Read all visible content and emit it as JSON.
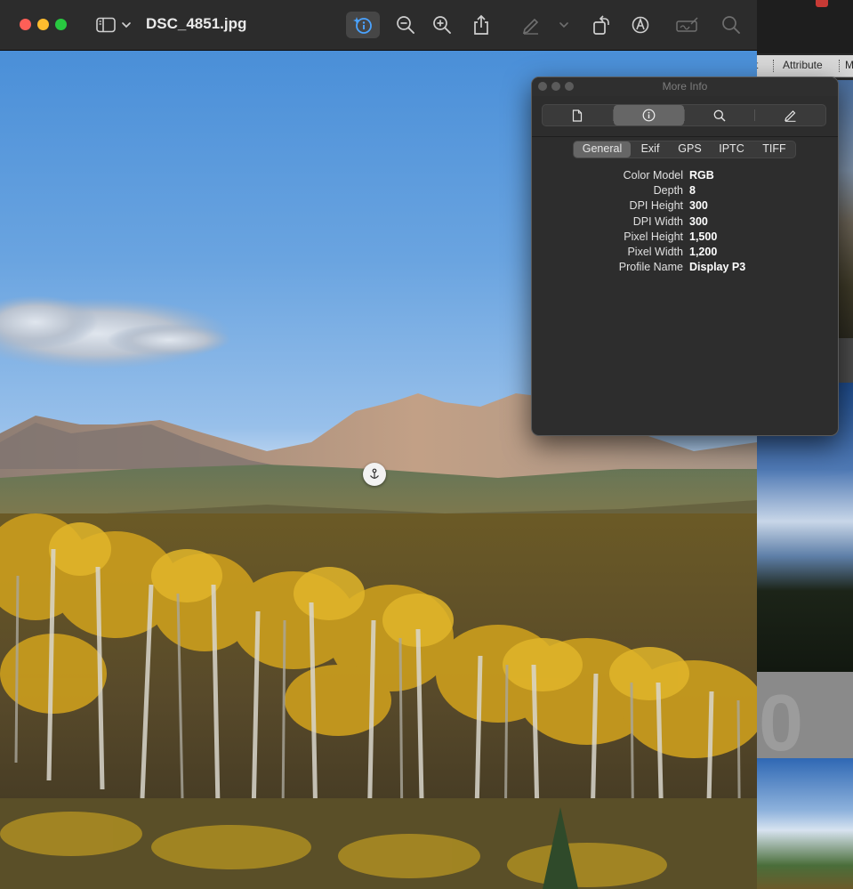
{
  "window": {
    "title": "DSC_4851.jpg"
  },
  "toolbar": {
    "sidebar_icon": "sidebar-icon",
    "sidebar_chevron_icon": "chevron-down-icon",
    "info_icon": "info-icon",
    "zoom_out_icon": "zoom-out-icon",
    "zoom_in_icon": "zoom-in-icon",
    "share_icon": "share-icon",
    "markup_pen_icon": "pen-icon",
    "markup_chevron_icon": "chevron-down-icon",
    "rotate_icon": "rotate-icon",
    "annotate_icon": "markup-circle-icon",
    "signature_icon": "signature-icon",
    "search_icon": "search-icon"
  },
  "background_app": {
    "tabs": [
      "t",
      "Attribute",
      "M"
    ],
    "big_text": "0"
  },
  "more_info": {
    "title": "More Info",
    "segments": [
      {
        "icon": "document-icon"
      },
      {
        "icon": "info-circle-icon",
        "active": true
      },
      {
        "icon": "magnifier-icon"
      },
      {
        "icon": "pencil-icon"
      }
    ],
    "tabs": [
      "General",
      "Exif",
      "GPS",
      "IPTC",
      "TIFF"
    ],
    "active_tab": "General",
    "rows": [
      {
        "key": "Color Model",
        "value": "RGB"
      },
      {
        "key": "Depth",
        "value": "8"
      },
      {
        "key": "DPI Height",
        "value": "300"
      },
      {
        "key": "DPI Width",
        "value": "300"
      },
      {
        "key": "Pixel Height",
        "value": "1,500"
      },
      {
        "key": "Pixel Width",
        "value": "1,200"
      },
      {
        "key": "Profile Name",
        "value": "Display P3"
      }
    ]
  },
  "colors": {
    "close": "#fe5f57",
    "minimize": "#febc2e",
    "zoom": "#28c840",
    "accent_info": "#4aa3ff"
  }
}
